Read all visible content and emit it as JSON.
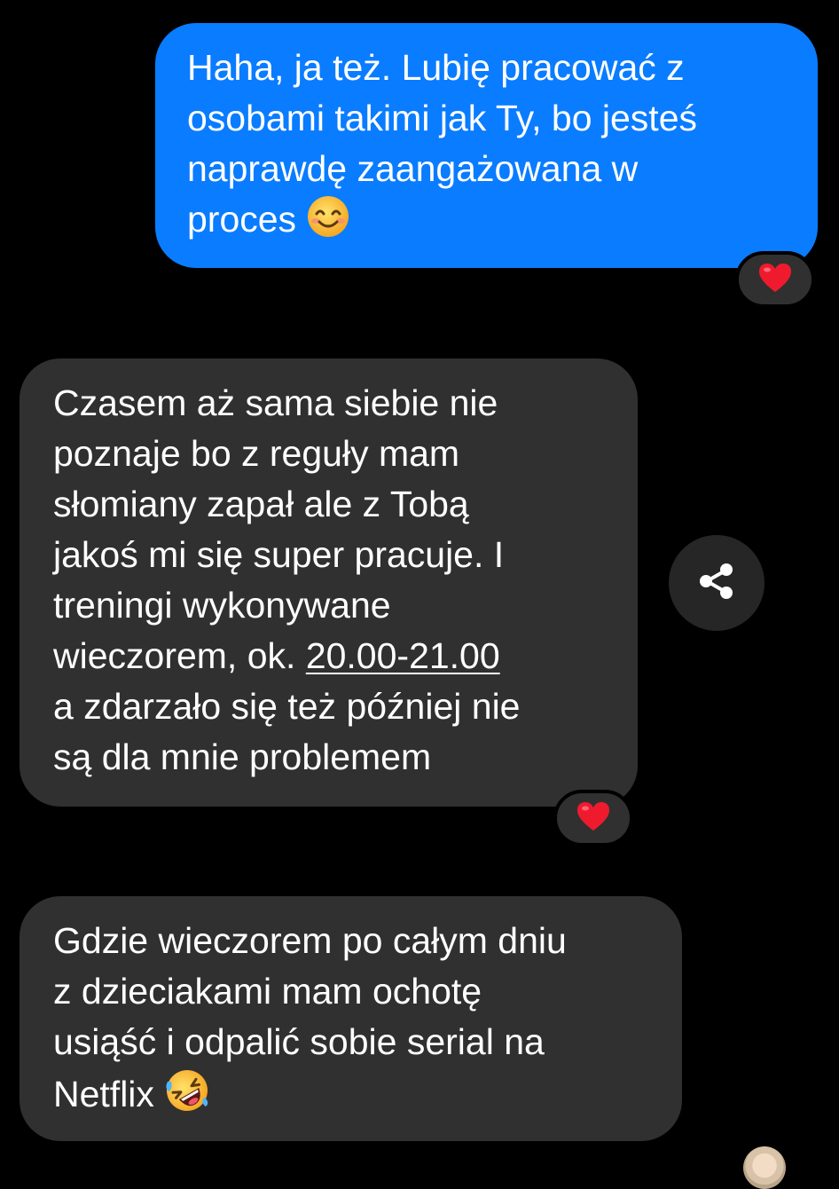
{
  "messages": [
    {
      "direction": "sent",
      "lines": [
        "Haha, ja też. Lubię pracować z",
        "osobami takimi jak Ty, bo jesteś",
        "naprawdę zaangażowana w"
      ],
      "last_line_text": "proces",
      "emoji": "smiling-face-with-smiling-eyes-icon",
      "reaction": "heart-icon",
      "bubble_color": "#0a7cff"
    },
    {
      "direction": "received",
      "lines": [
        "Czasem aż sama siebie nie",
        "poznaje bo z reguły mam",
        "słomiany zapał ale z Tobą",
        "jakoś mi się super pracuje. I",
        "treningi wykonywane"
      ],
      "line6_prefix": "wieczorem, ok. ",
      "line6_link": "20.00-21.00",
      "lines_after": [
        "a zdarzało się też później nie",
        "są dla mnie problemem"
      ],
      "reaction": "heart-icon",
      "bubble_color": "#303030"
    },
    {
      "direction": "received",
      "lines": [
        "Gdzie wieczorem po całym dniu",
        "z dzieciakami mam ochotę",
        "usiąść i odpalić sobie serial na"
      ],
      "last_line_text": "Netflix",
      "emoji": "rolling-on-the-floor-laughing-icon",
      "bubble_color": "#303030"
    }
  ],
  "share_button_icon": "share-icon",
  "read_receipt_icon": "avatar"
}
